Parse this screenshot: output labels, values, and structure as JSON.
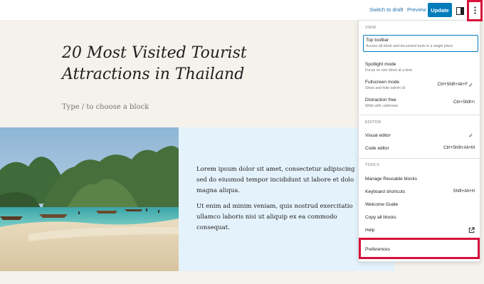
{
  "topbar": {
    "switch_to_draft": "Switch to draft",
    "preview": "Preview",
    "update": "Update"
  },
  "editor": {
    "post_title": "20 Most Visited Tourist Attractions in Thailand",
    "block_placeholder": "Type / to choose a block",
    "media_text": {
      "paragraphs": [
        "Lorem ipsum dolor sit amet, consectetur adipiscing",
        "sed do eiusmod tempor incididunt ut labore et dolo",
        "magna aliqua.",
        "Ut enim ad minim veniam, quis nostrud exercitatio",
        "ullamco laboris nisi ut aliquip ex ea commodo",
        "consequat."
      ]
    }
  },
  "options_menu": {
    "view": {
      "title": "VIEW",
      "items": [
        {
          "label": "Top toolbar",
          "desc": "Access all block and document tools in a single place",
          "shortcut": "",
          "checked": false
        },
        {
          "label": "Spotlight mode",
          "desc": "Focus on one block at a time",
          "shortcut": "",
          "checked": false
        },
        {
          "label": "Fullscreen mode",
          "desc": "Show and hide admin UI",
          "shortcut": "Ctrl+Shift+Alt+F",
          "checked": true
        },
        {
          "label": "Distraction free",
          "desc": "Write with calmness",
          "shortcut": "Ctrl+Shift+\\",
          "checked": false
        }
      ]
    },
    "editor": {
      "title": "EDITOR",
      "items": [
        {
          "label": "Visual editor",
          "shortcut": "",
          "checked": true
        },
        {
          "label": "Code editor",
          "shortcut": "Ctrl+Shift+Alt+M",
          "checked": false
        }
      ]
    },
    "tools": {
      "title": "TOOLS",
      "items": [
        {
          "label": "Manage Reusable blocks",
          "shortcut": ""
        },
        {
          "label": "Keyboard shortcuts",
          "shortcut": "Shift+Alt+H"
        },
        {
          "label": "Welcome Guide",
          "shortcut": ""
        },
        {
          "label": "Copy all blocks",
          "shortcut": ""
        },
        {
          "label": "Help",
          "shortcut": "",
          "icon": "external-link-icon"
        }
      ]
    },
    "preferences": "Preferences"
  },
  "colors": {
    "accent": "#007cba",
    "highlight": "#d6113b",
    "canvas_bg": "#f5f2ec",
    "media_text_bg": "#e4f3fb"
  }
}
